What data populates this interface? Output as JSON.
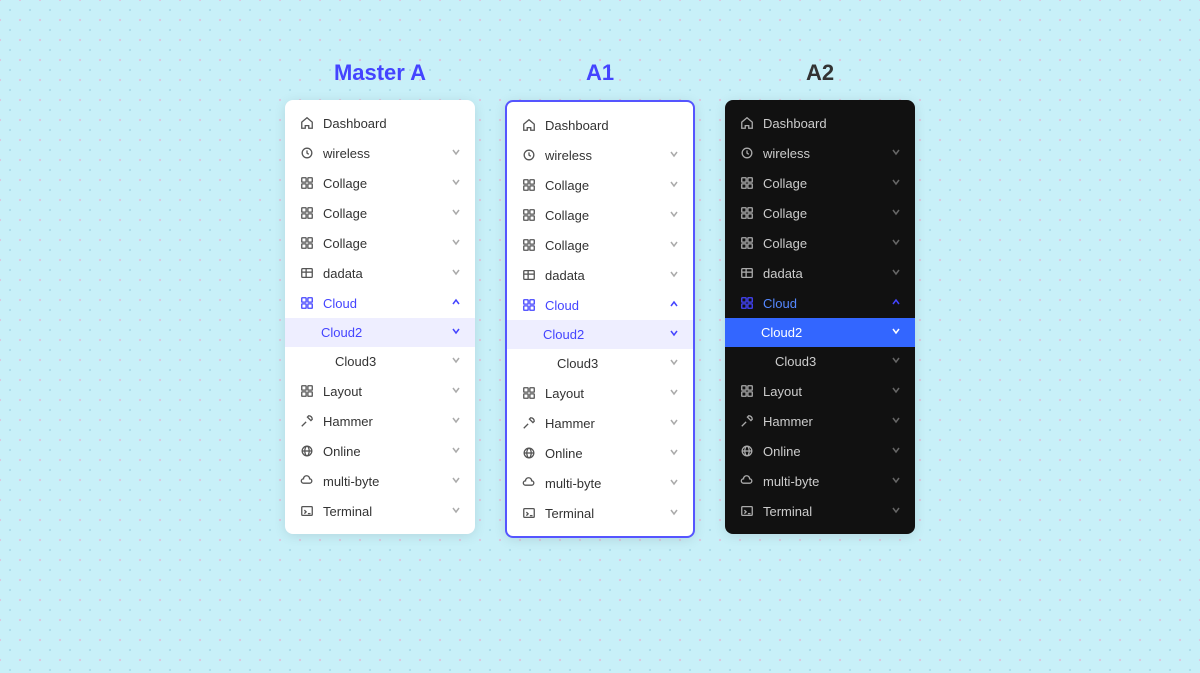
{
  "panels": [
    {
      "id": "master-a",
      "title": "Master A",
      "titleColor": "#4444ff",
      "theme": "light",
      "outlined": false,
      "items": [
        {
          "id": "dashboard",
          "label": "Dashboard",
          "icon": "home",
          "chevron": null,
          "state": "normal"
        },
        {
          "id": "wireless",
          "label": "wireless",
          "icon": "clock",
          "chevron": "down",
          "state": "normal"
        },
        {
          "id": "collage1",
          "label": "Collage",
          "icon": "grid",
          "chevron": "down",
          "state": "normal"
        },
        {
          "id": "collage2",
          "label": "Collage",
          "icon": "grid",
          "chevron": "down",
          "state": "normal"
        },
        {
          "id": "collage3",
          "label": "Collage",
          "icon": "grid",
          "chevron": "down",
          "state": "normal"
        },
        {
          "id": "dadata",
          "label": "dadata",
          "icon": "table",
          "chevron": "down",
          "state": "normal"
        },
        {
          "id": "cloud",
          "label": "Cloud",
          "icon": "grid",
          "chevron": "up",
          "state": "active-parent"
        },
        {
          "id": "cloud2",
          "label": "Cloud2",
          "icon": null,
          "chevron": "down",
          "state": "cloud2"
        },
        {
          "id": "cloud3",
          "label": "Cloud3",
          "icon": null,
          "chevron": "down",
          "state": "cloud3"
        },
        {
          "id": "layout",
          "label": "Layout",
          "icon": "grid",
          "chevron": "down",
          "state": "normal"
        },
        {
          "id": "hammer",
          "label": "Hammer",
          "icon": "tool",
          "chevron": "down",
          "state": "normal"
        },
        {
          "id": "online",
          "label": "Online",
          "icon": "globe",
          "chevron": "down",
          "state": "normal"
        },
        {
          "id": "multibyte",
          "label": "multi-byte",
          "icon": "cloud",
          "chevron": "down",
          "state": "normal"
        },
        {
          "id": "terminal",
          "label": "Terminal",
          "icon": "terminal",
          "chevron": "down",
          "state": "normal"
        }
      ]
    },
    {
      "id": "a1",
      "title": "A1",
      "titleColor": "#4444ff",
      "theme": "light",
      "outlined": true,
      "items": [
        {
          "id": "dashboard",
          "label": "Dashboard",
          "icon": "home",
          "chevron": null,
          "state": "normal"
        },
        {
          "id": "wireless",
          "label": "wireless",
          "icon": "clock",
          "chevron": "down",
          "state": "normal"
        },
        {
          "id": "collage1",
          "label": "Collage",
          "icon": "grid",
          "chevron": "down",
          "state": "normal"
        },
        {
          "id": "collage2",
          "label": "Collage",
          "icon": "grid",
          "chevron": "down",
          "state": "normal"
        },
        {
          "id": "collage3",
          "label": "Collage",
          "icon": "grid",
          "chevron": "down",
          "state": "normal"
        },
        {
          "id": "dadata",
          "label": "dadata",
          "icon": "table",
          "chevron": "down",
          "state": "normal"
        },
        {
          "id": "cloud",
          "label": "Cloud",
          "icon": "grid",
          "chevron": "up",
          "state": "active-parent"
        },
        {
          "id": "cloud2",
          "label": "Cloud2",
          "icon": null,
          "chevron": "down",
          "state": "cloud2"
        },
        {
          "id": "cloud3",
          "label": "Cloud3",
          "icon": null,
          "chevron": "down",
          "state": "cloud3"
        },
        {
          "id": "layout",
          "label": "Layout",
          "icon": "grid",
          "chevron": "down",
          "state": "normal"
        },
        {
          "id": "hammer",
          "label": "Hammer",
          "icon": "tool",
          "chevron": "down",
          "state": "normal"
        },
        {
          "id": "online",
          "label": "Online",
          "icon": "globe",
          "chevron": "down",
          "state": "normal"
        },
        {
          "id": "multibyte",
          "label": "multi-byte",
          "icon": "cloud",
          "chevron": "down",
          "state": "normal"
        },
        {
          "id": "terminal",
          "label": "Terminal",
          "icon": "terminal",
          "chevron": "down",
          "state": "normal"
        }
      ]
    },
    {
      "id": "a2",
      "title": "A2",
      "titleColor": "#333",
      "theme": "dark",
      "outlined": false,
      "items": [
        {
          "id": "dashboard",
          "label": "Dashboard",
          "icon": "home",
          "chevron": null,
          "state": "normal"
        },
        {
          "id": "wireless",
          "label": "wireless",
          "icon": "clock",
          "chevron": "down",
          "state": "normal"
        },
        {
          "id": "collage1",
          "label": "Collage",
          "icon": "grid",
          "chevron": "down",
          "state": "normal"
        },
        {
          "id": "collage2",
          "label": "Collage",
          "icon": "grid",
          "chevron": "down",
          "state": "normal"
        },
        {
          "id": "collage3",
          "label": "Collage",
          "icon": "grid",
          "chevron": "down",
          "state": "normal"
        },
        {
          "id": "dadata",
          "label": "dadata",
          "icon": "table",
          "chevron": "down",
          "state": "normal"
        },
        {
          "id": "cloud",
          "label": "Cloud",
          "icon": "grid",
          "chevron": "up",
          "state": "active-parent"
        },
        {
          "id": "cloud2",
          "label": "Cloud2",
          "icon": null,
          "chevron": "down",
          "state": "cloud2"
        },
        {
          "id": "cloud3",
          "label": "Cloud3",
          "icon": null,
          "chevron": "down",
          "state": "cloud3"
        },
        {
          "id": "layout",
          "label": "Layout",
          "icon": "grid",
          "chevron": "down",
          "state": "normal"
        },
        {
          "id": "hammer",
          "label": "Hammer",
          "icon": "tool",
          "chevron": "down",
          "state": "normal"
        },
        {
          "id": "online",
          "label": "Online",
          "icon": "globe",
          "chevron": "down",
          "state": "normal"
        },
        {
          "id": "multibyte",
          "label": "multi-byte",
          "icon": "cloud",
          "chevron": "down",
          "state": "normal"
        },
        {
          "id": "terminal",
          "label": "Terminal",
          "icon": "terminal",
          "chevron": "down",
          "state": "normal"
        }
      ]
    }
  ],
  "icons": {
    "home": "🏠",
    "clock": "🕐",
    "grid": "⊞",
    "table": "⊟",
    "tool": "🔧",
    "globe": "🌐",
    "cloud": "☁",
    "terminal": "▣"
  }
}
